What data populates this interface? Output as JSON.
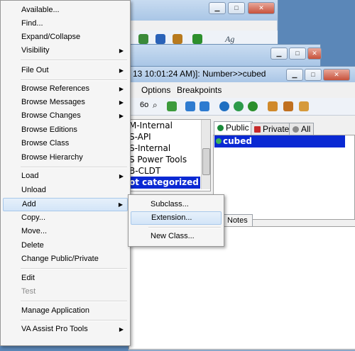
{
  "colors": {
    "desktop": "#5b87b8",
    "selection": "#0a29d3",
    "highlight": "#d3e5f8"
  },
  "front_window": {
    "title_visible": "13 10:01:24 AM)]: Number>>cubed",
    "menubar": [
      "Options",
      "Breakpoints"
    ],
    "category_list": [
      "M-Internal",
      "S-API",
      "S-Internal",
      "S Power Tools",
      "B-CLDT",
      "ot categorized"
    ],
    "selected_category": "ot categorized",
    "tabs": [
      "Public",
      "Private",
      "All"
    ],
    "active_tab": "Public",
    "methods": [
      "cubed"
    ],
    "lower_tab": "Notes"
  },
  "context_menu": {
    "items": [
      {
        "label": "Available...",
        "submenu": false
      },
      {
        "label": "Find...",
        "submenu": false
      },
      {
        "label": "Expand/Collapse",
        "submenu": false
      },
      {
        "label": "Visibility",
        "submenu": true
      },
      {
        "label": "File Out",
        "submenu": true
      },
      {
        "label": "Browse References",
        "submenu": true
      },
      {
        "label": "Browse Messages",
        "submenu": true
      },
      {
        "label": "Browse Changes",
        "submenu": true
      },
      {
        "label": "Browse Editions",
        "submenu": false
      },
      {
        "label": "Browse Class",
        "submenu": false
      },
      {
        "label": "Browse Hierarchy",
        "submenu": false
      },
      {
        "label": "Load",
        "submenu": true
      },
      {
        "label": "Unload",
        "submenu": false
      },
      {
        "label": "Add",
        "submenu": true,
        "highlighted": true
      },
      {
        "label": "Copy...",
        "submenu": false
      },
      {
        "label": "Move...",
        "submenu": false
      },
      {
        "label": "Delete",
        "submenu": false
      },
      {
        "label": "Change Public/Private",
        "submenu": false
      },
      {
        "label": "Edit",
        "submenu": false
      },
      {
        "label": "Test",
        "submenu": false,
        "disabled": true
      },
      {
        "label": "Manage Application",
        "submenu": false
      },
      {
        "label": "VA Assist Pro Tools",
        "submenu": true
      }
    ]
  },
  "submenu": {
    "items": [
      {
        "label": "Subclass..."
      },
      {
        "label": "Extension...",
        "highlighted": true
      },
      {
        "label": "New Class..."
      }
    ]
  },
  "background_window": {
    "toolbar_text": "Ag"
  }
}
